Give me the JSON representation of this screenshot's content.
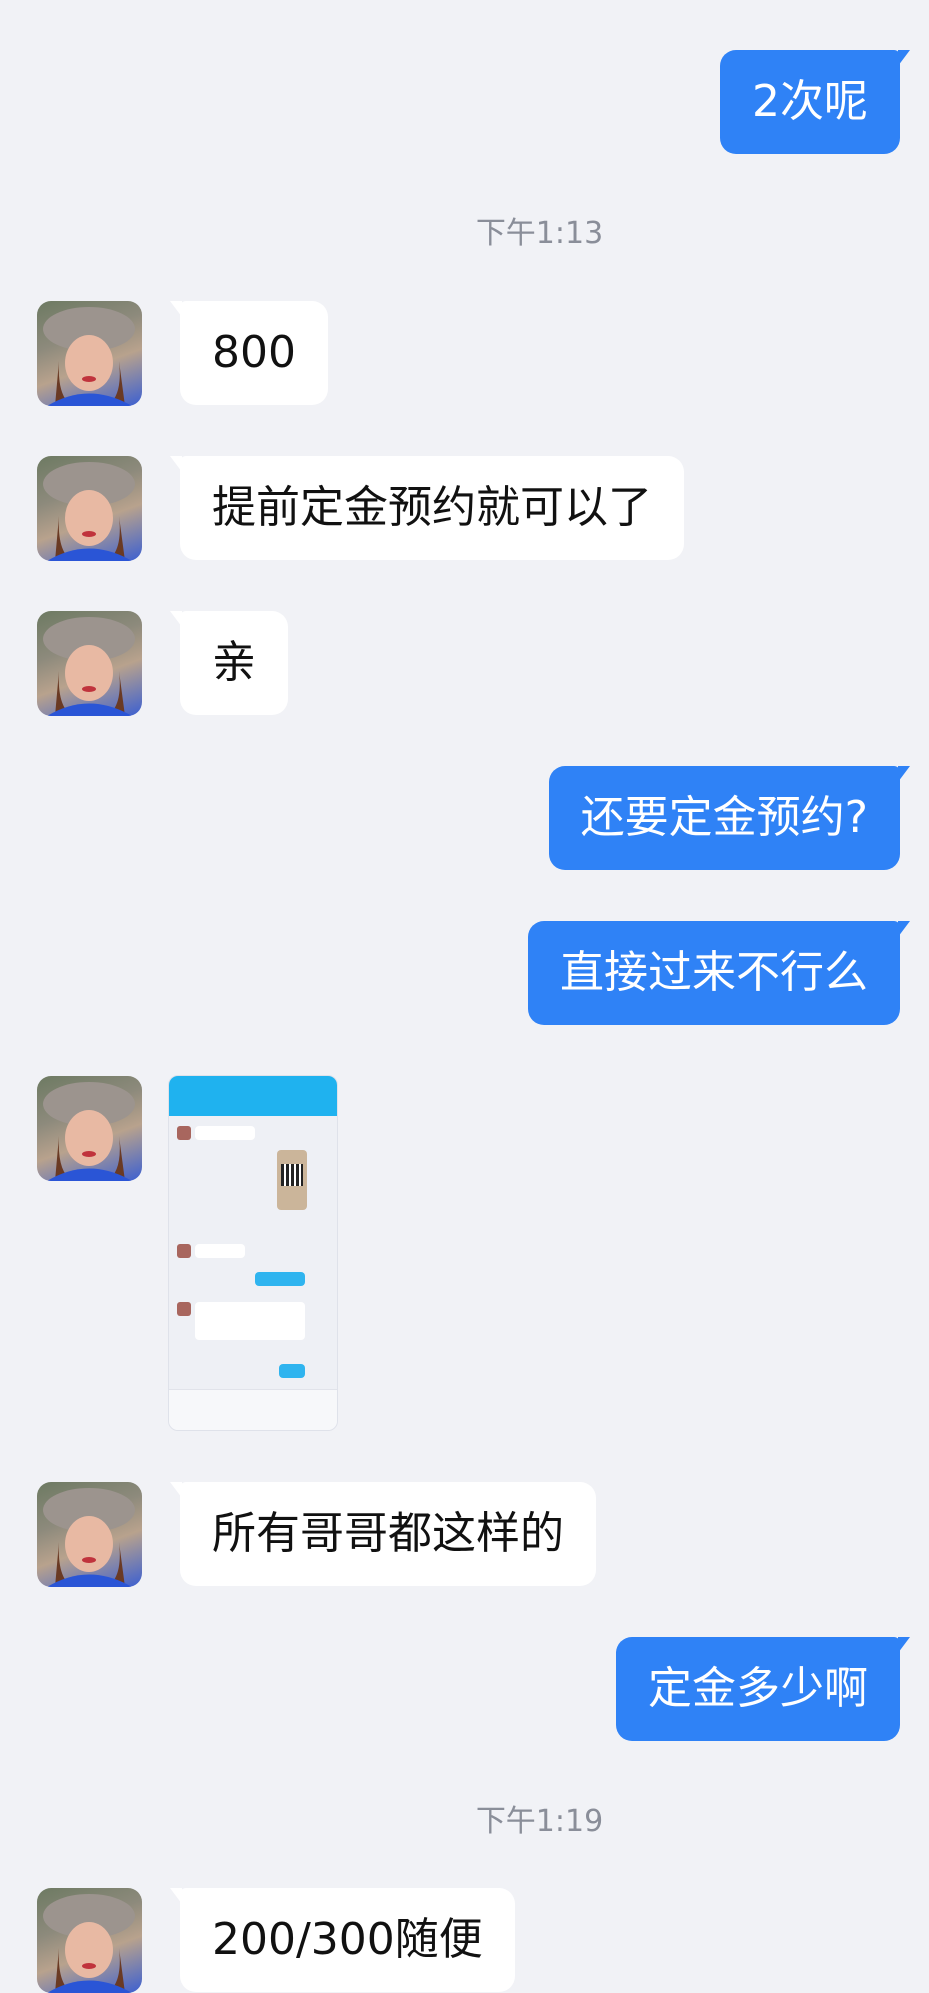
{
  "messages": {
    "m1": "2次呢",
    "t1": "下午1:13",
    "m2": "800",
    "m3": "提前定金预约就可以了",
    "m4": "亲",
    "m5": "还要定金预约?",
    "m6": "直接过来不行么",
    "m7": "所有哥哥都这样的",
    "m8": "定金多少啊",
    "t2": "下午1:19",
    "m9": "200/300随便"
  },
  "icons": {
    "avatar": "avatar-icon",
    "image": "image-thumbnail"
  },
  "colors": {
    "background": "#f1f2f6",
    "outgoing_bubble": "#2f82f6",
    "incoming_bubble": "#ffffff",
    "timestamp": "#8a8e99"
  }
}
